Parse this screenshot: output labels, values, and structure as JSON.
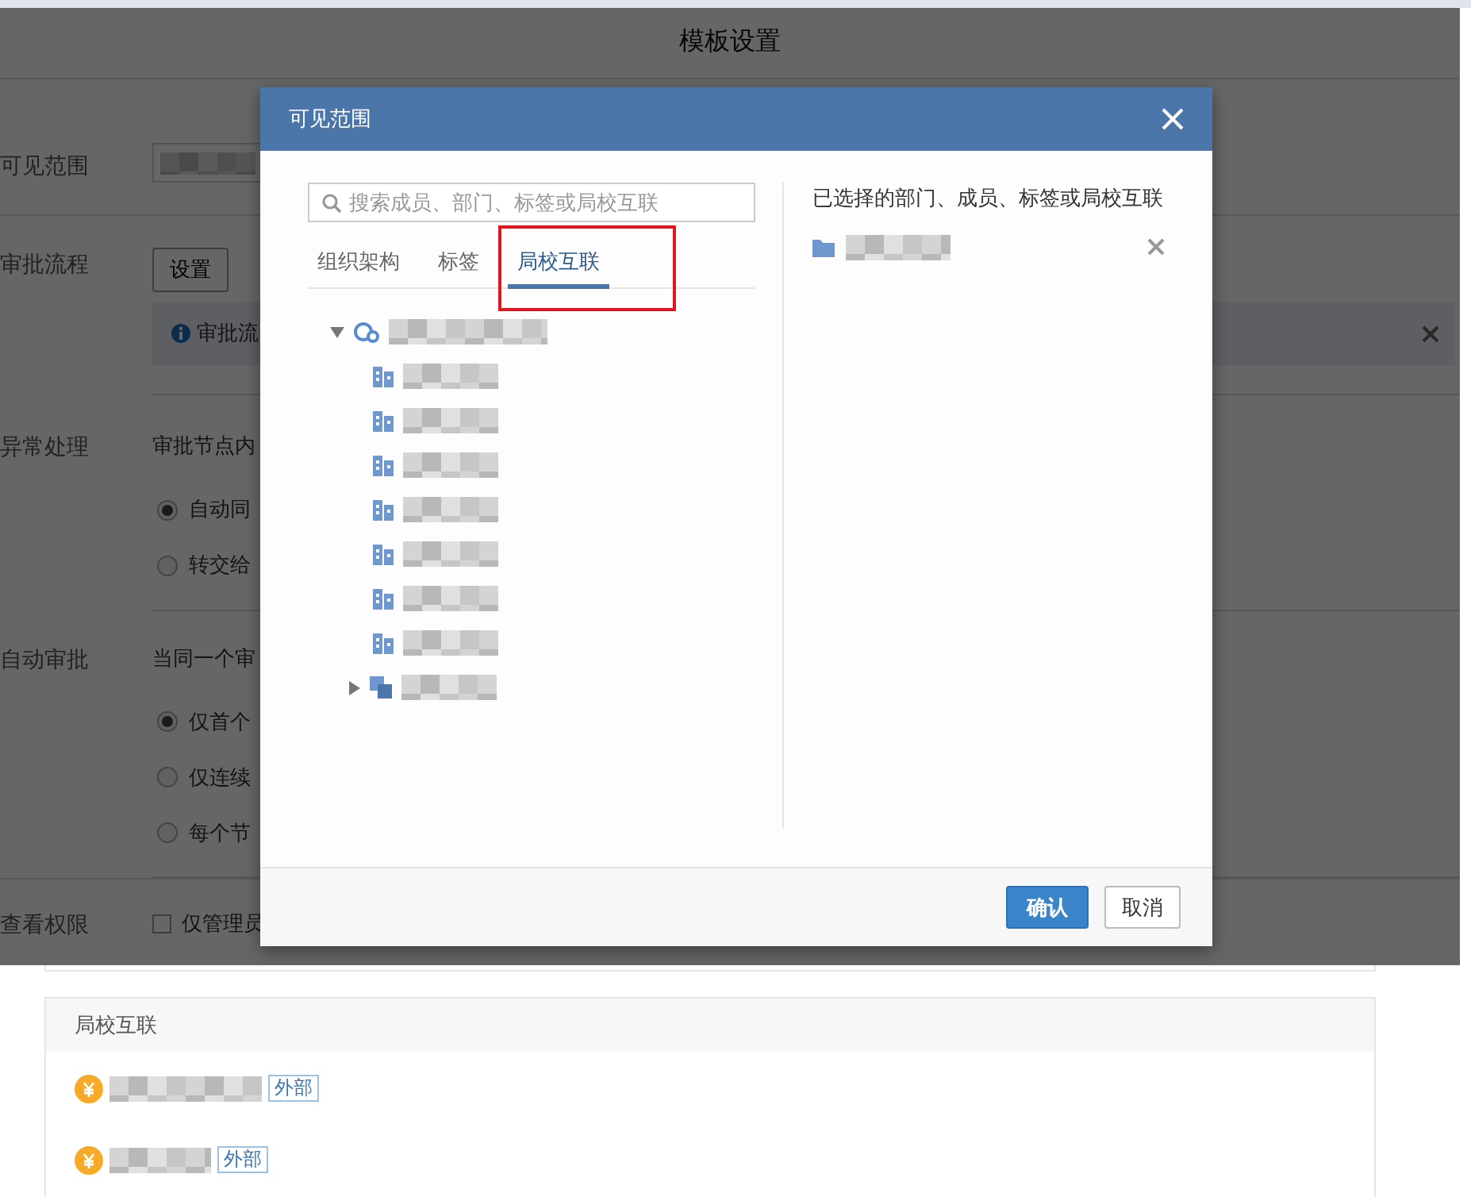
{
  "page_title": "模板设置",
  "form": [
    {
      "label": "可见范围",
      "kind": "field"
    },
    {
      "label": "审批流程",
      "kind": "button_alert",
      "button": "设置",
      "alert": "审批流"
    },
    {
      "label": "异常处理",
      "kind": "radios",
      "prompt": "审批节点内",
      "options": [
        {
          "label": "自动同",
          "selected": true
        },
        {
          "label": "转交给",
          "selected": false
        }
      ]
    },
    {
      "label": "自动审批",
      "kind": "radios",
      "prompt": "当同一个审",
      "options": [
        {
          "label": "仅首个",
          "selected": true
        },
        {
          "label": "仅连续",
          "selected": false
        },
        {
          "label": "每个节",
          "selected": false
        }
      ]
    },
    {
      "label": "查看权限",
      "kind": "checkbox",
      "text": "仅管理员",
      "checked": false
    }
  ],
  "dialog": {
    "title": "可见范围",
    "search": {
      "placeholder": "搜索成员、部门、标签或局校互联"
    },
    "tabs": [
      {
        "label": "组织架构",
        "selected": false
      },
      {
        "label": "标签",
        "selected": false
      },
      {
        "label": "局校互联",
        "selected": true,
        "highlighted": true
      }
    ],
    "tree": [
      {
        "kind": "org",
        "expanded": true,
        "children": [
          {
            "kind": "dept"
          },
          {
            "kind": "dept"
          },
          {
            "kind": "dept"
          },
          {
            "kind": "dept"
          },
          {
            "kind": "dept"
          },
          {
            "kind": "dept"
          },
          {
            "kind": "dept"
          },
          {
            "kind": "group",
            "expanded": false
          }
        ]
      }
    ],
    "selected_heading": "已选择的部门、成员、标签或局校互联",
    "selected_items": [
      {
        "kind": "folder"
      }
    ],
    "buttons": [
      {
        "label": "确认",
        "kind": "primary"
      },
      {
        "label": "取消",
        "kind": "secondary"
      }
    ]
  },
  "panel": {
    "title": "局校互联",
    "items": [
      {
        "badge": "外部"
      },
      {
        "badge": "外部"
      }
    ]
  }
}
